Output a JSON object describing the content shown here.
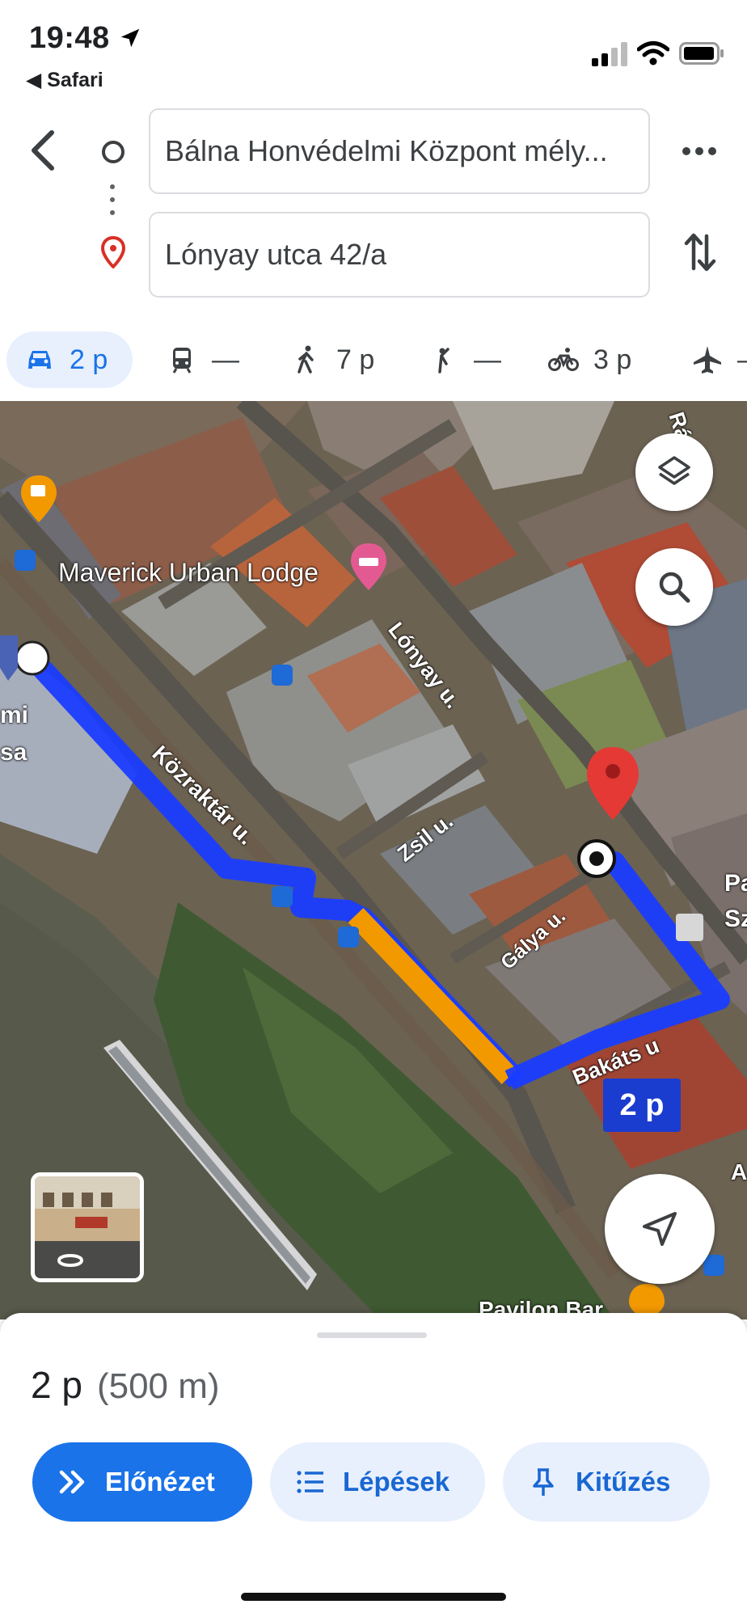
{
  "status_bar": {
    "time": "19:48",
    "back_app": "◀ Safari"
  },
  "search": {
    "origin_value": "Bálna Honvédelmi Központ mély...",
    "destination_value": "Lónyay utca 42/a"
  },
  "modes": [
    {
      "name": "car",
      "value": "2 p",
      "active": true
    },
    {
      "name": "transit",
      "value": "—"
    },
    {
      "name": "walk",
      "value": "7 p"
    },
    {
      "name": "ride",
      "value": "—"
    },
    {
      "name": "bike",
      "value": "3 p"
    },
    {
      "name": "flight",
      "value": "—"
    }
  ],
  "map": {
    "labels": {
      "lodge": "Maverick Urban Lodge",
      "kozraktar": "Közraktár u.",
      "lonyay": "Lónyay u.",
      "zsil": "Zsil u.",
      "galya": "Gálya u.",
      "bakats": "Bakáts u",
      "raday": "Ráday u.",
      "pavilon": "Pavilon Bar",
      "edge1": "mi",
      "edge2": "sa",
      "edge3": "Pa",
      "edge4": "Sz",
      "edge5": "A"
    },
    "eta_badge": "2 p",
    "route_color": "#1a3cff",
    "traffic_color": "#f29900"
  },
  "sheet": {
    "duration": "2 p",
    "distance": "(500 m)",
    "preview_label": "Előnézet",
    "steps_label": "Lépések",
    "pin_label": "Kitűzés"
  }
}
